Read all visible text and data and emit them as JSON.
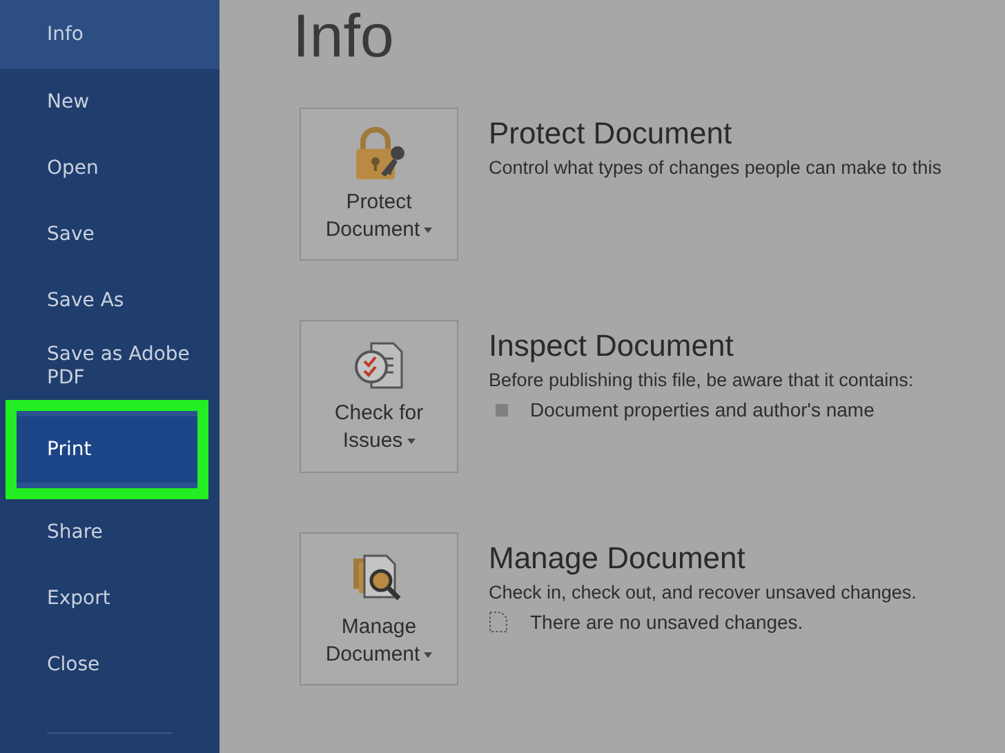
{
  "sidebar": {
    "items": [
      {
        "label": "Info",
        "selected": true,
        "highlighted": false
      },
      {
        "label": "New",
        "selected": false,
        "highlighted": false
      },
      {
        "label": "Open",
        "selected": false,
        "highlighted": false
      },
      {
        "label": "Save",
        "selected": false,
        "highlighted": false
      },
      {
        "label": "Save As",
        "selected": false,
        "highlighted": false
      },
      {
        "label": "Save as Adobe PDF",
        "selected": false,
        "highlighted": false
      },
      {
        "label": "Print",
        "selected": false,
        "highlighted": true
      },
      {
        "label": "Share",
        "selected": false,
        "highlighted": false
      },
      {
        "label": "Export",
        "selected": false,
        "highlighted": false
      },
      {
        "label": "Close",
        "selected": false,
        "highlighted": false
      }
    ]
  },
  "page_title": "Info",
  "sections": [
    {
      "kind": "protect",
      "button": [
        "Protect",
        "Document"
      ],
      "heading": "Protect Document",
      "description": "Control what types of changes people can make to this"
    },
    {
      "kind": "inspect",
      "button": [
        "Check for",
        "Issues"
      ],
      "heading": "Inspect Document",
      "description": "Before publishing this file, be aware that it contains:",
      "details": [
        {
          "kind": "bullet",
          "text": "Document properties and author's name"
        }
      ]
    },
    {
      "kind": "manage",
      "button": [
        "Manage",
        "Document"
      ],
      "heading": "Manage Document",
      "description": "Check in, check out, and recover unsaved changes.",
      "details": [
        {
          "kind": "file",
          "text": "There are no unsaved changes."
        }
      ]
    }
  ]
}
